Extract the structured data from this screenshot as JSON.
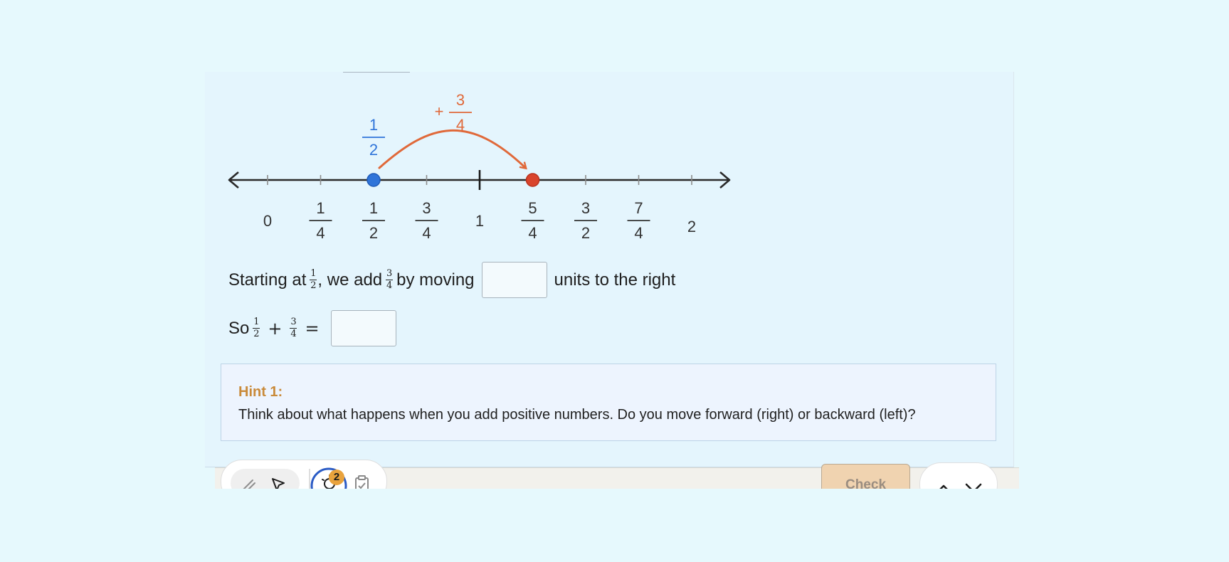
{
  "number_line": {
    "jump_label_sign": "+",
    "jump_label_num": "3",
    "jump_label_den": "4",
    "start_label_num": "1",
    "start_label_den": "2",
    "ticks": [
      {
        "type": "whole",
        "text": "0"
      },
      {
        "type": "frac",
        "num": "1",
        "den": "4"
      },
      {
        "type": "frac",
        "num": "1",
        "den": "2"
      },
      {
        "type": "frac",
        "num": "3",
        "den": "4"
      },
      {
        "type": "whole",
        "text": "1"
      },
      {
        "type": "frac",
        "num": "5",
        "den": "4"
      },
      {
        "type": "frac",
        "num": "3",
        "den": "2"
      },
      {
        "type": "frac",
        "num": "7",
        "den": "4"
      },
      {
        "type": "whole",
        "text": "2"
      }
    ],
    "start_value": 0.5,
    "end_value": 1.25,
    "colors": {
      "start": "#2f74d9",
      "jump": "#e0693a",
      "line": "#2a2a2a"
    }
  },
  "question1": {
    "part1": "Starting at",
    "frac1_num": "1",
    "frac1_den": "2",
    "part2": ", we add",
    "frac2_num": "3",
    "frac2_den": "4",
    "part3": "by moving",
    "part4": "units to the right"
  },
  "question2": {
    "part1": "So",
    "frac1_num": "1",
    "frac1_den": "2",
    "plus": "+",
    "frac2_num": "3",
    "frac2_den": "4",
    "equals": "="
  },
  "hint": {
    "title": "Hint 1:",
    "body": "Think about what happens when you add positive numbers. Do you move forward (right) or backward (left)?"
  },
  "toolbar": {
    "hint_count": "2",
    "check_label": "Check"
  },
  "icons": [
    "pencil-icon",
    "pointer-icon",
    "lightbulb-icon",
    "clipboard-icon",
    "chevron-up-icon",
    "chevron-down-icon"
  ]
}
